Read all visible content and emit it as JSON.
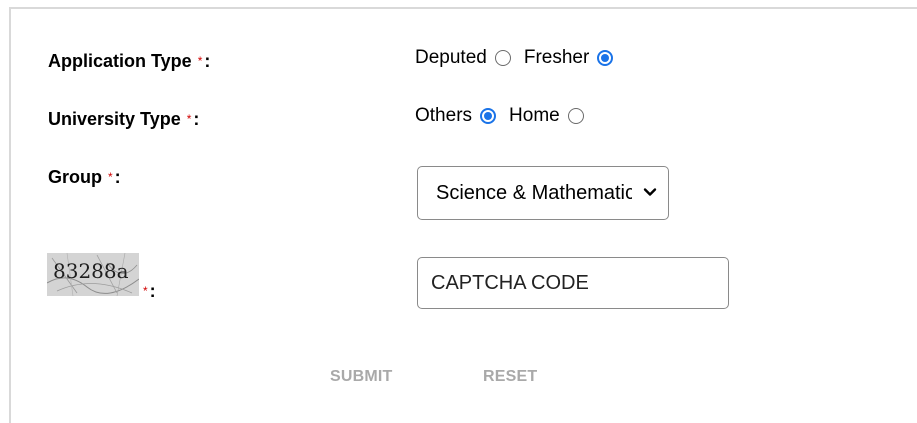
{
  "form": {
    "application_type": {
      "label": "Application Type",
      "required_mark": "*",
      "colon": ":",
      "options": [
        {
          "label": "Deputed",
          "checked": false
        },
        {
          "label": "Fresher",
          "checked": true
        }
      ]
    },
    "university_type": {
      "label": "University Type",
      "required_mark": "*",
      "colon": ":",
      "options": [
        {
          "label": "Others",
          "checked": true
        },
        {
          "label": "Home",
          "checked": false
        }
      ]
    },
    "group": {
      "label": "Group",
      "required_mark": "*",
      "colon": ":",
      "selected_value": "Science & Mathematics"
    },
    "captcha": {
      "image_text": "83288a",
      "required_mark": "*",
      "colon": ":",
      "input_value": "CAPTCHA CODE"
    },
    "buttons": {
      "submit_label": "SUBMIT",
      "reset_label": "RESET"
    }
  },
  "colors": {
    "accent": "#1a73e8",
    "required": "#d00000",
    "disabled_button": "#a9a9a9"
  }
}
